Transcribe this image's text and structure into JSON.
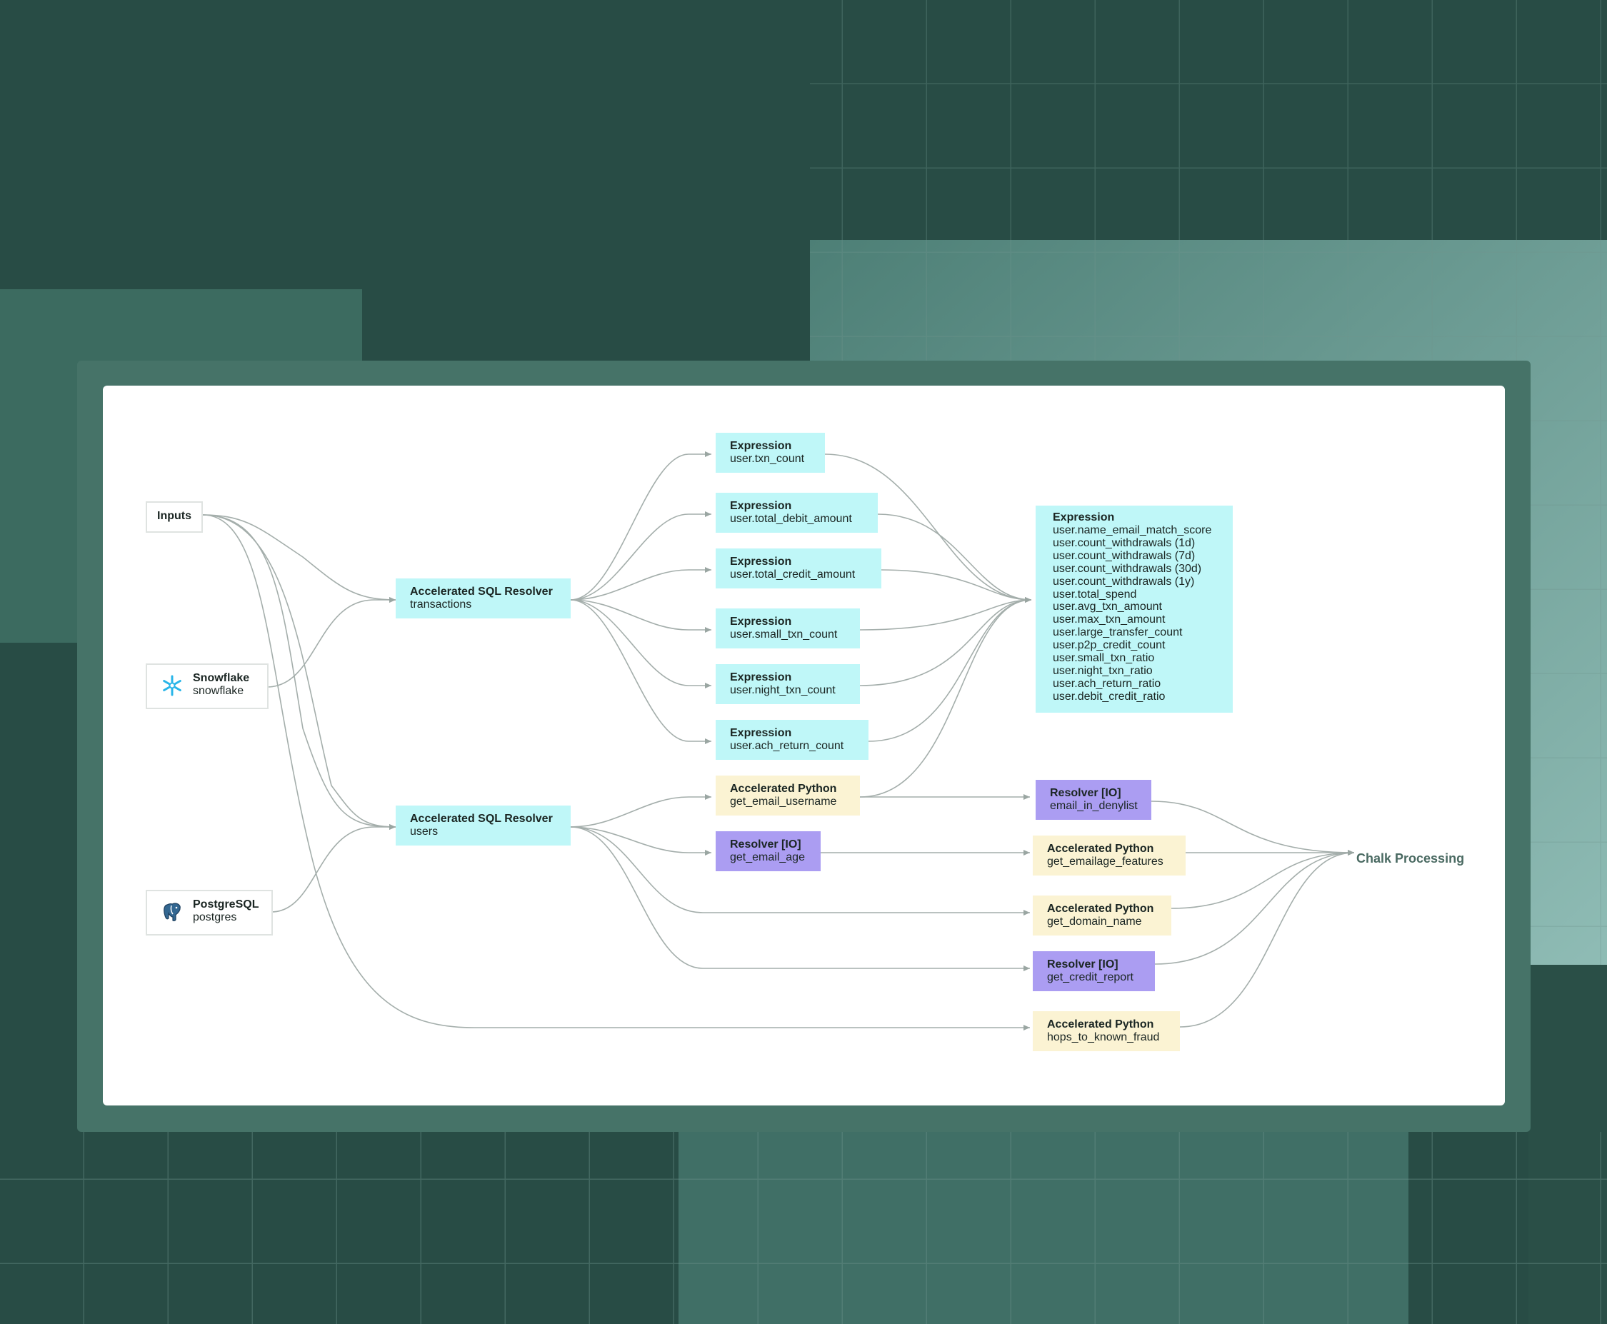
{
  "diagram": {
    "inputs": {
      "label": "Inputs"
    },
    "snowflake": {
      "title": "Snowflake",
      "subtitle": "snowflake",
      "icon": "snowflake-icon"
    },
    "postgres": {
      "title": "PostgreSQL",
      "subtitle": "postgres",
      "icon": "postgresql-elephant-icon"
    },
    "sql_transactions": {
      "title": "Accelerated SQL Resolver",
      "subtitle": "transactions"
    },
    "sql_users": {
      "title": "Accelerated SQL Resolver",
      "subtitle": "users"
    },
    "expressions": [
      {
        "title": "Expression",
        "subtitle": "user.txn_count"
      },
      {
        "title": "Expression",
        "subtitle": "user.total_debit_amount"
      },
      {
        "title": "Expression",
        "subtitle": "user.total_credit_amount"
      },
      {
        "title": "Expression",
        "subtitle": "user.small_txn_count"
      },
      {
        "title": "Expression",
        "subtitle": "user.night_txn_count"
      },
      {
        "title": "Expression",
        "subtitle": "user.ach_return_count"
      }
    ],
    "py_email_username": {
      "title": "Accelerated Python",
      "subtitle": "get_email_username"
    },
    "io_email_age": {
      "title": "Resolver [IO]",
      "subtitle": "get_email_age"
    },
    "big_expression": {
      "title": "Expression",
      "items": [
        "user.name_email_match_score",
        "user.count_withdrawals (1d)",
        "user.count_withdrawals (7d)",
        "user.count_withdrawals (30d)",
        "user.count_withdrawals (1y)",
        "user.total_spend",
        "user.avg_txn_amount",
        "user.max_txn_amount",
        "user.large_transfer_count",
        "user.p2p_credit_count",
        "user.small_txn_ratio",
        "user.night_txn_ratio",
        "user.ach_return_ratio",
        "user.debit_credit_ratio"
      ]
    },
    "io_denylist": {
      "title": "Resolver [IO]",
      "subtitle": "email_in_denylist"
    },
    "py_emailage_features": {
      "title": "Accelerated Python",
      "subtitle": "get_emailage_features"
    },
    "py_domain_name": {
      "title": "Accelerated Python",
      "subtitle": "get_domain_name"
    },
    "io_credit_report": {
      "title": "Resolver [IO]",
      "subtitle": "get_credit_report"
    },
    "py_known_fraud": {
      "title": "Accelerated Python",
      "subtitle": "hops_to_known_fraud"
    },
    "output": {
      "label": "Chalk Processing"
    }
  },
  "colors": {
    "background": "#284c45",
    "frame": "#467368",
    "expression_node": "#bff7f8",
    "python_node": "#fbf3d3",
    "io_node": "#ab9df2",
    "edge": "#a4aeab"
  }
}
